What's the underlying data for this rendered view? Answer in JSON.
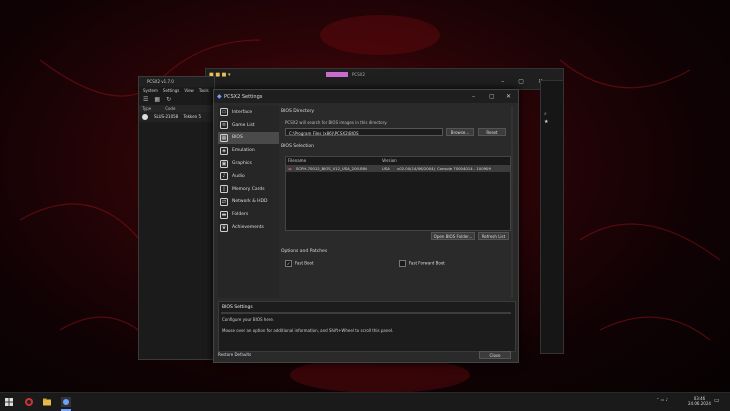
{
  "explorer": {
    "tab_title": "PCSX2"
  },
  "main_window": {
    "title": "PCSX2 v1.7.0",
    "menu": [
      "System",
      "Settings",
      "View",
      "Tools"
    ],
    "columns": [
      "Type",
      "Code",
      "Title"
    ],
    "row": {
      "code": "SLUS-21058",
      "title": "Tekken 5"
    }
  },
  "dialog": {
    "title": "PCSX2 Settings",
    "sidebar": [
      {
        "label": "Interface",
        "icon": "monitor-icon"
      },
      {
        "label": "Game List",
        "icon": "list-icon"
      },
      {
        "label": "BIOS",
        "icon": "chip-icon"
      },
      {
        "label": "Emulation",
        "icon": "emulation-icon"
      },
      {
        "label": "Graphics",
        "icon": "image-icon"
      },
      {
        "label": "Audio",
        "icon": "speaker-icon"
      },
      {
        "label": "Memory Cards",
        "icon": "memory-card-icon"
      },
      {
        "label": "Network & HDD",
        "icon": "network-icon"
      },
      {
        "label": "Folders",
        "icon": "folder-icon"
      },
      {
        "label": "Achievements",
        "icon": "trophy-icon"
      }
    ],
    "selected_index": 2,
    "bios_directory": {
      "heading": "BIOS Directory",
      "description": "PCSX2 will search for BIOS images in this directory.",
      "path": "C:\\Program Files (x86)\\PCSX2\\BIOS",
      "browse_label": "Browse...",
      "reset_label": "Reset"
    },
    "bios_selection": {
      "heading": "BIOS Selection",
      "columns": [
        "Filename",
        "Version"
      ],
      "rows": [
        {
          "filename": "SCPH-70012_BIOS_V12_USA_200.BIN",
          "region": "USA",
          "version": "v02.00(14/06/2004)",
          "type": "Console 70004014 - 100909"
        }
      ],
      "open_folder_label": "Open BIOS Folder...",
      "refresh_label": "Refresh List"
    },
    "options": {
      "heading": "Options and Patches",
      "fast_boot": {
        "label": "Fast Boot",
        "checked": true
      },
      "fast_forward_boot": {
        "label": "Fast Forward Boot",
        "checked": false
      }
    },
    "info": {
      "title": "BIOS Settings",
      "line1": "Configure your BIOS here.",
      "line2": "Mouse over an option for additional information, and Shift+Wheel to scroll this panel."
    },
    "restore_label": "Restore Defaults",
    "close_label": "Close"
  },
  "taskbar": {
    "time": "03:46",
    "date": "24.06.2024"
  }
}
